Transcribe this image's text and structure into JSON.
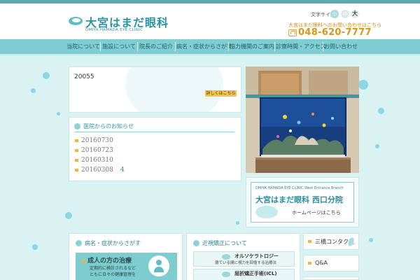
{
  "header": {
    "clinic_name": "大宮はまだ眼科",
    "clinic_name_en": "OMIYA HAMADA EYE CLINIC",
    "font_size_label": "文字サイズ",
    "font_size_options": [
      "小",
      "中",
      "大"
    ],
    "contact_caption": "大宮はまだ眼科へのお問い合わせはこちら",
    "phone": "048-620-7777"
  },
  "nav": {
    "items": [
      "当院について",
      "施設について",
      "院長のご紹介",
      "病名・症状からさがす",
      "協力機関のご案内",
      "診察時間・アクセス",
      "お問い合わせ"
    ]
  },
  "hero": {
    "number": "20055",
    "link_label": "詳しくはこちら"
  },
  "news": {
    "title": "医院からのお知らせ",
    "items": [
      {
        "date": "20160730",
        "badge": ""
      },
      {
        "date": "20160723",
        "badge": ""
      },
      {
        "date": "20160310",
        "badge": ""
      },
      {
        "date": "20160308",
        "badge": "4"
      }
    ]
  },
  "branch": {
    "name_en": "OMIYA HAMADA EYE CLINIC West Entrance Branch",
    "name": "大宮はまだ眼科 西口分院",
    "link": "ホームページはこちら"
  },
  "symptoms": {
    "title": "病名・症状からさがす",
    "adult_title": "成人の方の治療",
    "adult_desc_line1": "定期的に検診されるなど",
    "adult_desc_line2": "ともに日々の健康管理を"
  },
  "vision": {
    "title": "近視矯正について",
    "items": [
      {
        "label": "オルソケラトロジー",
        "desc": "寝ている間に視力を回復する治療法"
      },
      {
        "label": "屈折矯正手術(ICL)",
        "desc": ""
      }
    ]
  },
  "side_links": [
    "三橋コンタク堂",
    "Q&A"
  ],
  "colors": {
    "brand": "#2a94a2",
    "nav_bg": "#7fcdd0",
    "accent": "#d7961c",
    "background": "#d9f3f3"
  }
}
